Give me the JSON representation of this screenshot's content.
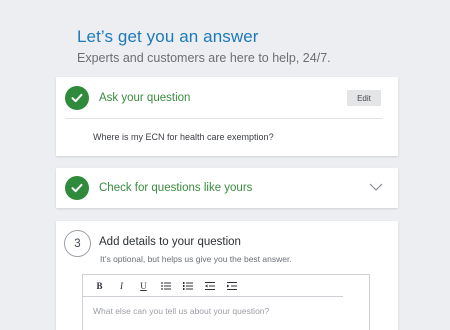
{
  "header": {
    "title": "Let’s get you an answer",
    "subtitle": "Experts and customers are here to help, 24/7."
  },
  "step1": {
    "icon": "check-icon",
    "title": "Ask your question",
    "edit_label": "Edit",
    "question": "Where is my ECN for health care exemption?"
  },
  "step2": {
    "icon": "check-icon",
    "title": "Check for questions like yours",
    "expand_icon": "chevron-down-icon"
  },
  "step3": {
    "number": "3",
    "title": "Add details to your question",
    "hint": "It’s optional, but helps us give you the best answer.",
    "toolbar": {
      "bold": "B",
      "italic": "I",
      "underline": "U"
    },
    "placeholder": "What else can you tell us about your question?"
  },
  "colors": {
    "accent_blue": "#1d7ab8",
    "success_green": "#2f8a3b"
  }
}
